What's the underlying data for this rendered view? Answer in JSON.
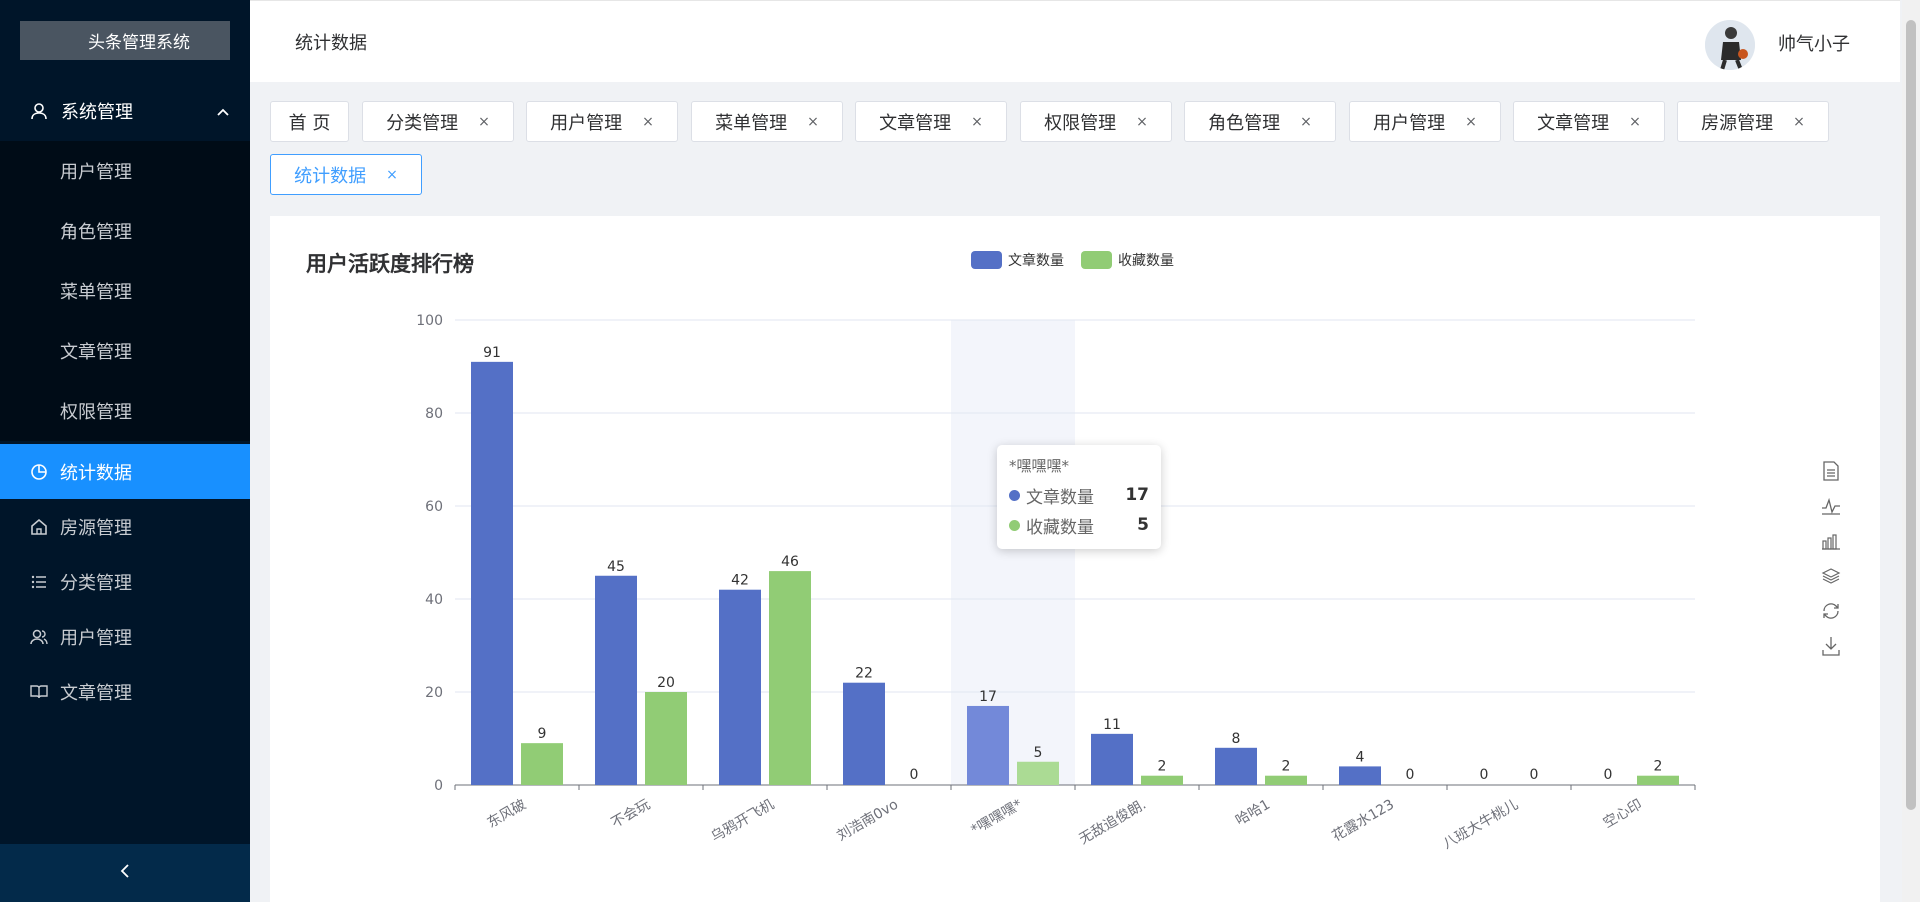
{
  "app": {
    "logo_text": "头条管理系统"
  },
  "sidebar": {
    "group": {
      "label": "系统管理",
      "icon": "user-icon",
      "expanded": true
    },
    "sub_items": [
      {
        "label": "用户管理"
      },
      {
        "label": "角色管理"
      },
      {
        "label": "菜单管理"
      },
      {
        "label": "文章管理"
      },
      {
        "label": "权限管理"
      }
    ],
    "items": [
      {
        "label": "统计数据",
        "icon": "pie-chart-icon",
        "active": true
      },
      {
        "label": "房源管理",
        "icon": "home-icon"
      },
      {
        "label": "分类管理",
        "icon": "list-icon"
      },
      {
        "label": "用户管理",
        "icon": "users-icon"
      },
      {
        "label": "文章管理",
        "icon": "book-icon"
      }
    ],
    "collapse_icon": "chevron-left-icon"
  },
  "header": {
    "title": "统计数据",
    "username": "帅气小子",
    "avatar_icon": "avatar-image"
  },
  "tabs": [
    {
      "label": "首 页",
      "closable": false
    },
    {
      "label": "分类管理",
      "closable": true
    },
    {
      "label": "用户管理",
      "closable": true
    },
    {
      "label": "菜单管理",
      "closable": true
    },
    {
      "label": "文章管理",
      "closable": true
    },
    {
      "label": "权限管理",
      "closable": true
    },
    {
      "label": "角色管理",
      "closable": true
    },
    {
      "label": "用户管理",
      "closable": true
    },
    {
      "label": "文章管理",
      "closable": true
    },
    {
      "label": "房源管理",
      "closable": true
    },
    {
      "label": "统计数据",
      "closable": true,
      "active": true
    }
  ],
  "tab_close_glyph": "×",
  "colors": {
    "series1": "#5470c6",
    "series2": "#91cc75",
    "active_blue": "#1890ff",
    "sidebar_bg": "#001529"
  },
  "toolbox": [
    "data-view-icon",
    "line-chart-icon",
    "bar-chart-icon",
    "stack-icon",
    "restore-icon",
    "save-image-icon"
  ],
  "chart_data": {
    "type": "bar",
    "title": "用户活跃度排行榜",
    "categories": [
      "东风破",
      "不会玩",
      "乌鸦开飞机",
      "刘浩南0vo",
      "*嘿嘿嘿*",
      "无敌追俊朗.",
      "哈哈1",
      "花露水123",
      "八班大牛桃儿",
      "空心印"
    ],
    "series": [
      {
        "name": "文章数量",
        "values": [
          91,
          45,
          42,
          22,
          17,
          11,
          8,
          4,
          0,
          0
        ]
      },
      {
        "name": "收藏数量",
        "values": [
          9,
          20,
          46,
          0,
          5,
          2,
          2,
          0,
          0,
          2
        ]
      }
    ],
    "ylim": [
      0,
      100
    ],
    "yticks": [
      "0",
      "20",
      "40",
      "60",
      "80",
      "100"
    ],
    "grid": true,
    "legend": "top-center",
    "highlighted_category": "*嘿嘿嘿*",
    "tooltip": {
      "title": "*嘿嘿嘿*",
      "rows": [
        {
          "name": "文章数量",
          "value": "17"
        },
        {
          "name": "收藏数量",
          "value": "5"
        }
      ]
    }
  }
}
